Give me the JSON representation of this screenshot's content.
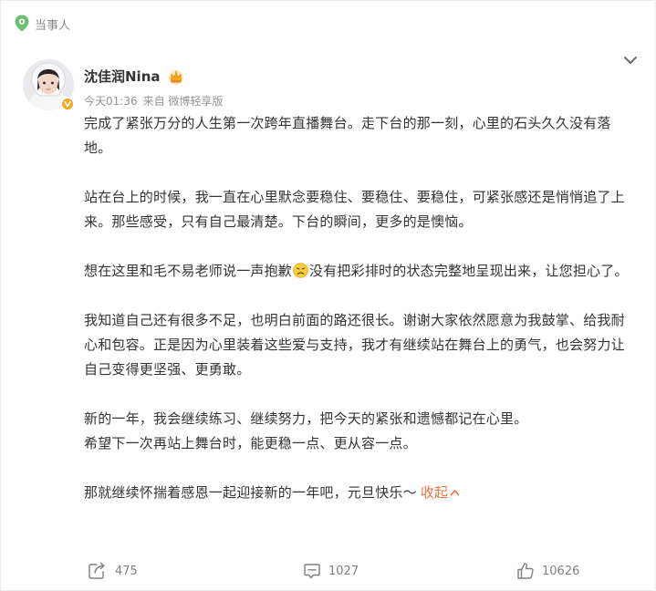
{
  "tag": {
    "label": "当事人",
    "icon": "location-pin-icon"
  },
  "post": {
    "author": "沈佳润Nina",
    "time": "今天01:36",
    "source": "来自 微博轻享版",
    "paragraphs": [
      {
        "text": "完成了紧张万分的人生第一次跨年直播舞台。走下台的那一刻，心里的石头久久没有落地。"
      },
      {
        "text": "站在台上的时候，我一直在心里默念要稳住、要稳住、要稳住，可紧张感还是悄悄追了上来。那些感受，只有自己最清楚。下台的瞬间，更多的是懊恼。"
      },
      {
        "before": "想在这里和毛不易老师说一声抱歉",
        "after": "没有把彩排时的状态完整地呈现出来，让您担心了。",
        "emoji": "sad-face-emoji"
      },
      {
        "text": "我知道自己还有很多不足，也明白前面的路还很长。谢谢大家依然愿意为我鼓掌、给我耐心和包容。正是因为心里装着这些爱与支持，我才有继续站在舞台上的勇气，也会努力让自己变得更坚强、更勇敢。"
      },
      {
        "line1": "新的一年，我会继续练习、继续努力，把今天的紧张和遗憾都记在心里。",
        "line2": "希望下一次再站上舞台时，能更稳一点、更从容一点。"
      },
      {
        "text": "那就继续怀揣着感恩一起迎接新的一年吧，元旦快乐～"
      }
    ],
    "collapse_label": "收起"
  },
  "actions": {
    "reposts": "475",
    "comments": "1027",
    "likes": "10626"
  },
  "colors": {
    "accent": "#eb7340",
    "verified_badge": "#f5a623",
    "tag_icon": "#5cb85c",
    "meta_text": "#939393"
  }
}
